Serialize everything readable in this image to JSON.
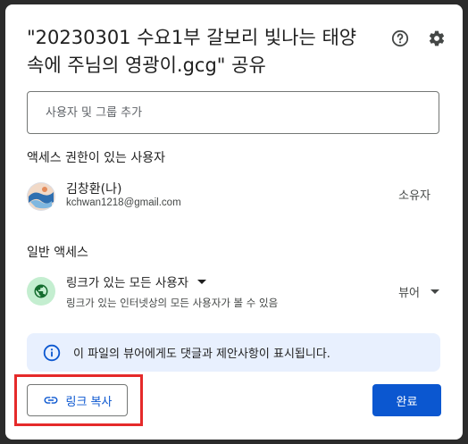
{
  "dialog": {
    "title": "\"20230301 수요1부 갈보리 빛나는 태양 속에 주님의 영광이.gcg\" 공유",
    "help_icon": "help-circle-icon",
    "settings_icon": "gear-icon"
  },
  "add_people": {
    "placeholder": "사용자 및 그룹 추가"
  },
  "people_section": {
    "heading": "액세스 권한이 있는 사용자",
    "users": [
      {
        "name": "김창환(나)",
        "email": "kchwan1218@gmail.com",
        "role": "소유자"
      }
    ]
  },
  "general_access": {
    "heading": "일반 액세스",
    "icon": "globe-icon",
    "selected": "링크가 있는 모든 사용자",
    "description": "링크가 있는 인터넷상의 모든 사용자가 볼 수 있음",
    "role": "뷰어"
  },
  "info": {
    "icon": "info-icon",
    "text": "이 파일의 뷰어에게도 댓글과 제안사항이 표시됩니다."
  },
  "actions": {
    "copy_link_label": "링크 복사",
    "done_label": "완료"
  },
  "colors": {
    "accent": "#0b57d0",
    "info_bg": "#e8f0fe",
    "globe_bg": "#c4eed0",
    "highlight": "#e52a2a"
  }
}
